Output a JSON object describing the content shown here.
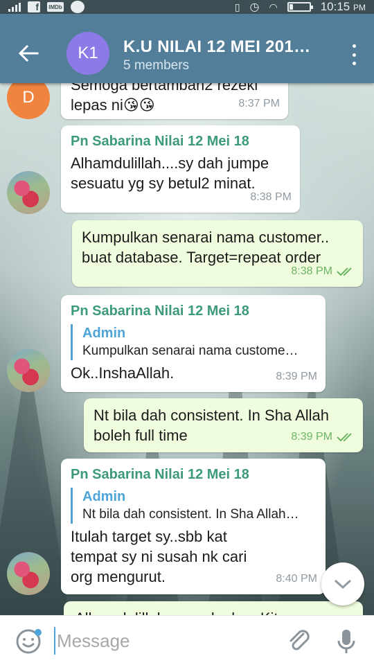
{
  "status_bar": {
    "time": "10:15",
    "ampm": "PM",
    "imdb_label": "IMDb"
  },
  "header": {
    "avatar_initials": "K1",
    "title": "K.U NILAI 12 MEI 201…",
    "subtitle": "5 members",
    "header_color": "#537e9a"
  },
  "messages": [
    {
      "direction": "in",
      "avatar_initial": "D",
      "text": "Semoga bertambah2 rezeki\nlepas ni😘😘",
      "time": "8:37 PM"
    },
    {
      "direction": "in",
      "sender": "Pn Sabarina Nilai 12 Mei 18",
      "text": "Alhamdulillah....sy dah jumpe\nsesuatu yg sy betul2 minat.",
      "time": "8:38 PM"
    },
    {
      "direction": "out",
      "text": "Kumpulkan senarai nama customer..\nbuat database. Target=repeat order",
      "time": "8:38 PM"
    },
    {
      "direction": "in",
      "sender": "Pn Sabarina Nilai 12 Mei 18",
      "quote_name": "Admin",
      "quote_text": "Kumpulkan senarai nama custome…",
      "text": "Ok..InshaAllah.",
      "time": "8:39 PM"
    },
    {
      "direction": "out",
      "text": "Nt bila dah consistent. In Sha Allah\nboleh full time",
      "time": "8:39 PM"
    },
    {
      "direction": "in",
      "sender": "Pn Sabarina Nilai 12 Mei 18",
      "quote_name": "Admin",
      "quote_text": "Nt bila dah consistent. In Sha Allah…",
      "text": "Itulah target sy..sbb kat\ntempat sy ni susah nk cari\norg mengurut.",
      "time": "8:40 PM"
    },
    {
      "direction": "out",
      "text": "Alhamdulillah...syg doakan Kita semua",
      "time": ""
    }
  ],
  "input": {
    "placeholder": "Message"
  },
  "colors": {
    "sender_name": "#3c9a7a",
    "quote_accent": "#4ea4d9",
    "outgoing_bubble": "#effdde",
    "read_check": "#6db565"
  },
  "icons": [
    "back-arrow-icon",
    "more-vert-icon",
    "double-check-icon",
    "chevron-down-icon",
    "emoji-icon",
    "attach-icon",
    "mic-icon"
  ]
}
